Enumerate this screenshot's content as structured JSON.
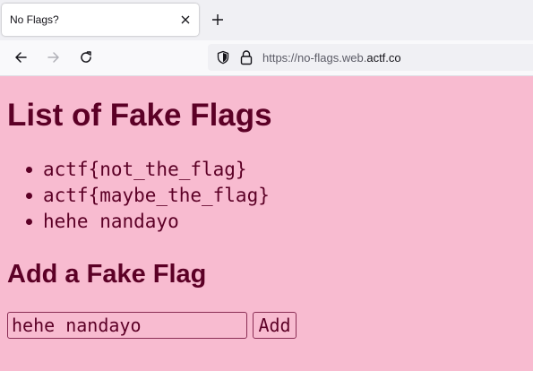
{
  "browser": {
    "tab": {
      "title": "No Flags?"
    },
    "url": {
      "prefix": "https://no-flags.web.",
      "domain": "actf.co"
    },
    "icons": {
      "back": "arrow-left-icon",
      "forward": "arrow-right-icon",
      "reload": "reload-icon",
      "close_tab": "close-icon",
      "new_tab": "plus-icon",
      "security": "shield-icon",
      "lock": "lock-icon"
    }
  },
  "page": {
    "background": "#f8bbd0",
    "text_color": "#5c0026",
    "heading": "List of Fake Flags",
    "flags": [
      "actf{not_the_flag}",
      "actf{maybe_the_flag}",
      "hehe nandayo"
    ],
    "form": {
      "heading": "Add a Fake Flag",
      "input_value": "hehe nandayo",
      "button_label": "Add"
    }
  }
}
